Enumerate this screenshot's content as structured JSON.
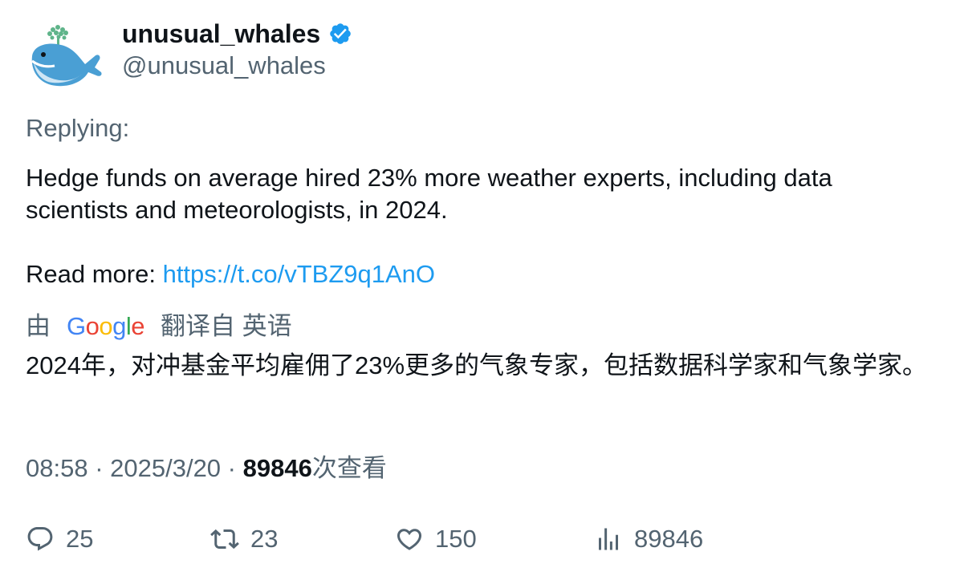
{
  "author": {
    "display_name": "unusual_whales",
    "handle": "@unusual_whales",
    "verified": true,
    "avatar_icon": "whale-logo"
  },
  "tweet": {
    "replying_label": "Replying:",
    "text": "Hedge funds on average hired 23% more weather experts, including data scientists and meteorologists, in 2024.",
    "read_more_label": "Read more: ",
    "link_text": "https://t.co/vTBZ9q1AnO"
  },
  "translation": {
    "by_label": "由",
    "provider": "Google",
    "translated_from_label": "翻译自 英语",
    "text": "2024年，对冲基金平均雇佣了23%更多的气象专家，包括数据科学家和气象学家。"
  },
  "meta": {
    "time": "08:58",
    "separator": " · ",
    "date": "2025/3/20",
    "views_count": "89846",
    "views_label": "次查看"
  },
  "actions": {
    "replies": "25",
    "retweets": "23",
    "likes": "150",
    "views": "89846"
  },
  "colors": {
    "link": "#1d9bf0",
    "verified": "#1d9bf0",
    "secondary_text": "#536471",
    "primary_text": "#0f1419"
  }
}
